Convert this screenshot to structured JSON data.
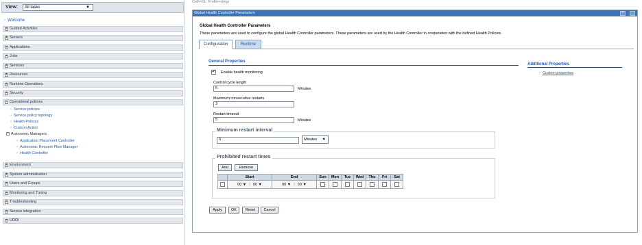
{
  "nav": {
    "view_label": "View:",
    "view_value": "All tasks",
    "welcome": "Welcome",
    "sections": [
      {
        "label": "Guided Activities",
        "sign": "+"
      },
      {
        "label": "Servers",
        "sign": "+"
      },
      {
        "label": "Applications",
        "sign": "+"
      },
      {
        "label": "Jobs",
        "sign": "+"
      },
      {
        "label": "Services",
        "sign": "+"
      },
      {
        "label": "Resources",
        "sign": "+"
      },
      {
        "label": "Runtime Operations",
        "sign": "+"
      },
      {
        "label": "Security",
        "sign": "+"
      },
      {
        "label": "Operational policies",
        "sign": "−"
      }
    ],
    "op_items": [
      "Service policies",
      "Service policy topology",
      "Health Policies",
      "Custom Action"
    ],
    "autonomic": {
      "label": "Autonomic Managers",
      "sign": "−",
      "items": [
        "Application Placement Controller",
        "Autonomic Request Flow Manager",
        "Health Controller"
      ]
    },
    "bottom_sections": [
      {
        "label": "Environment",
        "sign": "+"
      },
      {
        "label": "System administration",
        "sign": "+"
      },
      {
        "label": "Users and Groups",
        "sign": "+"
      },
      {
        "label": "Monitoring and Tuning",
        "sign": "+"
      },
      {
        "label": "Troubleshooting",
        "sign": "+"
      },
      {
        "label": "Service integration",
        "sign": "+"
      },
      {
        "label": "UDDI",
        "sign": "+"
      }
    ]
  },
  "breadcrumb": "Cell=VE, Profile=dmgr",
  "panel": {
    "title": "Global Health Controller Parameters",
    "help_btn": "?",
    "min_btn": "_",
    "heading": "Global Health Controller Parameters",
    "description": "These parameters are used to configure the global Health Controller parameters. These parameters are used by the Health Controller in cooperation with the defined Health Policies.",
    "tabs": [
      "Configuration",
      "Runtime"
    ]
  },
  "general": {
    "title": "General Properties",
    "enable_label": "Enable health monitoring",
    "control_cycle_label": "Control cycle length",
    "control_cycle_value": "5",
    "control_cycle_unit": "Minutes",
    "max_restarts_label": "Maximum consecutive restarts",
    "max_restarts_value": "3",
    "restart_timeout_label": "Restart timeout",
    "restart_timeout_value": "5",
    "restart_timeout_unit": "Minutes"
  },
  "min_interval": {
    "title": "Minimum restart interval",
    "value": "0",
    "unit": "Minutes",
    "unit_arrow": "▼"
  },
  "prohibited": {
    "title": "Prohibited restart times",
    "add": "Add",
    "remove": "Remove",
    "columns": [
      "Start",
      "End",
      "Sun",
      "Mon",
      "Tue",
      "Wed",
      "Thu",
      "Fri",
      "Sat"
    ],
    "row": {
      "start_h": "00",
      "start_m": "00",
      "end_h": "00",
      "end_m": "00"
    }
  },
  "additional": {
    "title": "Additional Properties",
    "link": "Custom properties"
  },
  "actions": [
    "Apply",
    "OK",
    "Reset",
    "Cancel"
  ]
}
